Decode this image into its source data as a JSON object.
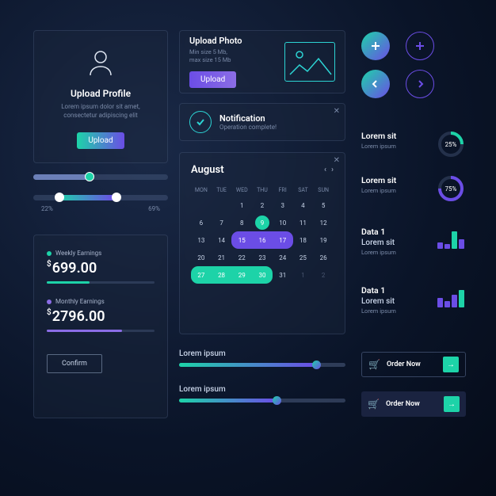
{
  "uploadProfile": {
    "title": "Upload Profile",
    "desc": "Lorem ipsum dolor sit amet, consectetur adipiscing elit",
    "button": "Upload"
  },
  "uploadPhoto": {
    "title": "Upload Photo",
    "line1": "Min size 5 Mb,",
    "line2": "max size 15 Mb",
    "button": "Upload"
  },
  "notification": {
    "title": "Notification",
    "message": "Operation complete!"
  },
  "rangeSlider": {
    "min": "22%",
    "max": "69%"
  },
  "earnings": {
    "weekly": {
      "label": "Weekly Earnings",
      "currency": "$",
      "value": "699.00",
      "pct": 40,
      "color": "#1dd3a8"
    },
    "monthly": {
      "label": "Monthly Earnings",
      "currency": "$",
      "value": "2796.00",
      "pct": 70,
      "color": "#8b6de6"
    },
    "confirm": "Confirm"
  },
  "calendar": {
    "month": "August",
    "dow": [
      "MON",
      "TUE",
      "WED",
      "THU",
      "FRI",
      "SAT",
      "SUN"
    ],
    "cells": [
      {
        "n": "",
        "dim": true
      },
      {
        "n": "",
        "dim": true
      },
      {
        "n": "1"
      },
      {
        "n": "2"
      },
      {
        "n": "3"
      },
      {
        "n": "4"
      },
      {
        "n": "5"
      },
      {
        "n": "6"
      },
      {
        "n": "7"
      },
      {
        "n": "8"
      },
      {
        "n": "9",
        "tealSel": true
      },
      {
        "n": "10"
      },
      {
        "n": "11"
      },
      {
        "n": "12"
      },
      {
        "n": "13"
      },
      {
        "n": "14"
      },
      {
        "n": "15",
        "pr": "start"
      },
      {
        "n": "16",
        "pr": "mid"
      },
      {
        "n": "17",
        "pr": "end"
      },
      {
        "n": "18"
      },
      {
        "n": "19"
      },
      {
        "n": "20"
      },
      {
        "n": "21"
      },
      {
        "n": "22"
      },
      {
        "n": "23"
      },
      {
        "n": "24"
      },
      {
        "n": "25"
      },
      {
        "n": "26"
      },
      {
        "n": "27",
        "teal": "start"
      },
      {
        "n": "28",
        "teal": "mid"
      },
      {
        "n": "29",
        "teal": "mid"
      },
      {
        "n": "30",
        "teal": "end"
      },
      {
        "n": "31"
      },
      {
        "n": "1",
        "dim": true
      },
      {
        "n": "2",
        "dim": true
      }
    ]
  },
  "stats": {
    "stat1": {
      "title": "Lorem sit",
      "sub": "Lorem ipsum",
      "pct": "25%",
      "val": 25
    },
    "stat2": {
      "title": "Lorem sit",
      "sub": "Lorem ipsum",
      "pct": "75%",
      "val": 75
    },
    "stat3": {
      "title": "Data 1",
      "sub": "Lorem sit",
      "text": "Lorem ipsum"
    },
    "stat4": {
      "title": "Data 1",
      "sub": "Lorem sit",
      "text": "Lorem ipsum"
    }
  },
  "loremSliders": {
    "s1": {
      "label": "Lorem ipsum",
      "pct": 82
    },
    "s2": {
      "label": "Lorem ipsum",
      "pct": 58
    }
  },
  "order": {
    "label": "Order Now"
  },
  "chart_data": [
    {
      "type": "bar",
      "title": "Data 1 mini",
      "values": [
        8,
        6,
        22,
        12
      ],
      "colors": [
        "#6b4de6",
        "#6b4de6",
        "#1dd3a8",
        "#6b4de6"
      ]
    },
    {
      "type": "bar",
      "title": "Data 1 mini 2",
      "values": [
        12,
        8,
        16,
        22
      ],
      "colors": [
        "#6b4de6",
        "#6b4de6",
        "#6b4de6",
        "#1dd3a8"
      ]
    }
  ]
}
